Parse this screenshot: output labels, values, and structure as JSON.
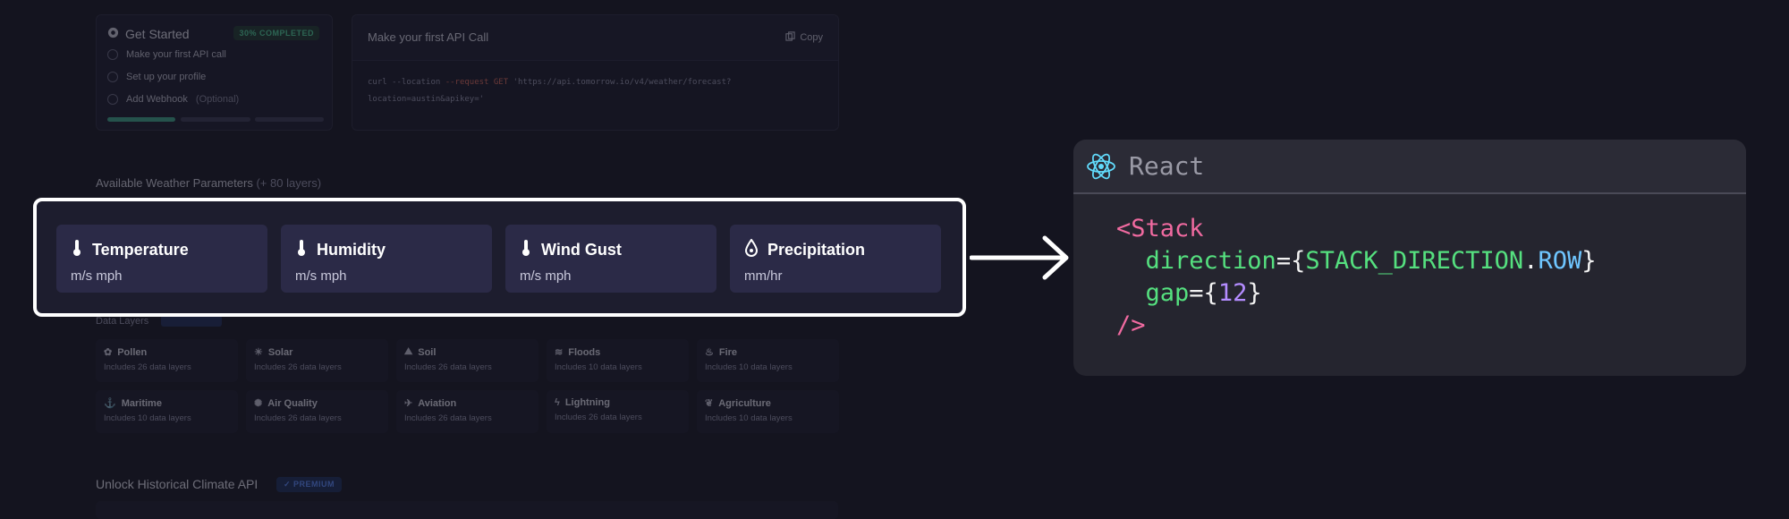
{
  "get_started": {
    "title": "Get Started",
    "badge": "30% COMPLETED",
    "progress_percent": 30,
    "items": [
      {
        "label": "Make your first API call",
        "optional": ""
      },
      {
        "label": "Set up your profile",
        "optional": ""
      },
      {
        "label": "Add Webhook",
        "optional": "(Optional)"
      }
    ]
  },
  "api_call": {
    "title": "Make your first API Call",
    "copy_label": "Copy",
    "code_line1_a": "curl --location ",
    "code_line1_flag": "--request GET",
    "code_line1_b": " 'https://api.tomorrow.io/v4/weather/forecast?",
    "code_line2": "location=austin&apikey='"
  },
  "weather_params": {
    "title": "Available Weather Parameters",
    "subtitle": "(+ 80 layers)"
  },
  "highlight_params": [
    {
      "icon": "thermometer-icon",
      "name": "Temperature",
      "units": "m/s mph"
    },
    {
      "icon": "thermometer-icon",
      "name": "Humidity",
      "units": "m/s mph"
    },
    {
      "icon": "thermometer-icon",
      "name": "Wind Gust",
      "units": "m/s mph"
    },
    {
      "icon": "droplet-icon",
      "name": "Precipitation",
      "units": "mm/hr"
    }
  ],
  "data_layers": {
    "label": "Data Layers",
    "items": [
      {
        "icon": "pollen-icon",
        "glyph": "✿",
        "name": "Pollen",
        "sub": "Includes 26 data layers"
      },
      {
        "icon": "solar-icon",
        "glyph": "☀",
        "name": "Solar",
        "sub": "Includes 26 data layers"
      },
      {
        "icon": "soil-icon",
        "glyph": "⛰",
        "name": "Soil",
        "sub": "Includes 26 data layers"
      },
      {
        "icon": "floods-icon",
        "glyph": "≋",
        "name": "Floods",
        "sub": "Includes 10 data layers"
      },
      {
        "icon": "fire-icon",
        "glyph": "♨",
        "name": "Fire",
        "sub": "Includes 10 data layers"
      },
      {
        "icon": "maritime-icon",
        "glyph": "⚓",
        "name": "Maritime",
        "sub": "Includes 10 data layers"
      },
      {
        "icon": "air-quality-icon",
        "glyph": "✺",
        "name": "Air Quality",
        "sub": "Includes 26 data layers"
      },
      {
        "icon": "aviation-icon",
        "glyph": "✈",
        "name": "Aviation",
        "sub": "Includes 26 data layers"
      },
      {
        "icon": "lightning-icon",
        "glyph": "ϟ",
        "name": "Lightning",
        "sub": "Includes 26 data layers"
      },
      {
        "icon": "agriculture-icon",
        "glyph": "❦",
        "name": "Agriculture",
        "sub": "Includes 10 data layers"
      }
    ]
  },
  "historical": {
    "title": "Unlock Historical Climate API",
    "badge": "✓ PREMIUM"
  },
  "react_card": {
    "title": "React",
    "open_tag": "<Stack",
    "prop1_name": "direction",
    "prop1_value_obj": "STACK_DIRECTION",
    "prop1_value_key": "ROW",
    "prop2_name": "gap",
    "prop2_value": "12",
    "close_tag": "/>"
  },
  "colors": {
    "background": "#14141f",
    "param_card": "#2b2a47",
    "highlight_border": "#ffffff",
    "progress_fill": "#3ea98a",
    "react_pink": "#f06aa0",
    "react_green": "#55e07f",
    "react_blue": "#6fc6ff",
    "react_purple": "#b48cff"
  }
}
